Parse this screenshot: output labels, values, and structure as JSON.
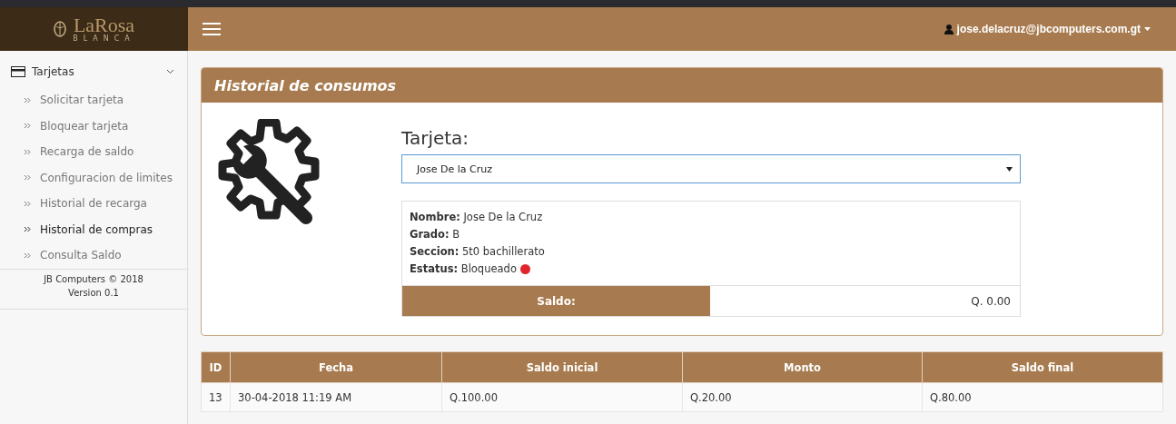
{
  "logo": {
    "name": "LaRosa",
    "tagline": "BLANCA"
  },
  "header": {
    "user": "jose.delacruz@jbcomputers.com.gt"
  },
  "sidebar": {
    "section": {
      "label": "Tarjetas",
      "expanded": true
    },
    "items": [
      {
        "label": "Solicitar tarjeta",
        "selected": false
      },
      {
        "label": "Bloquear tarjeta",
        "selected": false
      },
      {
        "label": "Recarga de saldo",
        "selected": false
      },
      {
        "label": "Configuracion de limites",
        "selected": false
      },
      {
        "label": "Historial de recarga",
        "selected": false
      },
      {
        "label": "Historial de compras",
        "selected": true
      },
      {
        "label": "Consulta Saldo",
        "selected": false
      }
    ],
    "footer": [
      "JB Computers © 2018",
      "Version 0.1"
    ]
  },
  "panel": {
    "title": "Historial de consumos",
    "select_label": "Tarjeta:",
    "select_value": "Jose De la Cruz",
    "fields": [
      {
        "label": "Nombre:",
        "value": "Jose De la Cruz"
      },
      {
        "label": "Grado:",
        "value": "B"
      },
      {
        "label": "Seccion:",
        "value": "5t0 bachillerato"
      },
      {
        "label": "Estatus:",
        "value": "Bloqueado",
        "color": "#e0262b"
      }
    ],
    "balance_label": "Saldo:",
    "balance_value": "Q. 0.00"
  },
  "table": {
    "columns": [
      "ID",
      "Fecha",
      "Saldo inicial",
      "Monto",
      "Saldo final"
    ],
    "rows": [
      [
        "13",
        "30-04-2018 11:19 AM",
        "Q.100.00",
        "Q.20.00",
        "Q.80.00"
      ]
    ]
  }
}
